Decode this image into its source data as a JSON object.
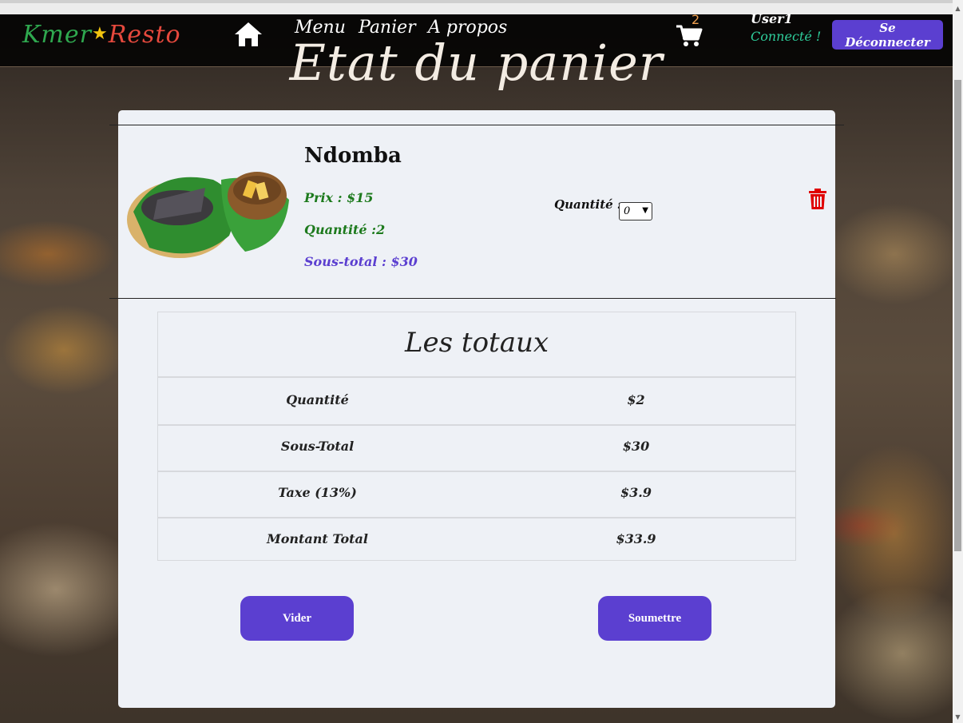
{
  "navbar": {
    "brand_part1": "Kmer",
    "brand_star": "★",
    "brand_part2": "Resto",
    "links": [
      "Menu",
      "Panier",
      "A propos"
    ],
    "cart_count": "2",
    "user_name": "User1",
    "user_status": "Connecté !",
    "logout_label": "Se Déconnecter"
  },
  "page": {
    "title": "Etat du panier"
  },
  "cart_item": {
    "name": "Ndomba",
    "price": "Prix : $15",
    "quantity": "Quantité :2",
    "subtotal": "Sous-total : $30",
    "qty_label": "Quantité :",
    "qty_select_value": "0"
  },
  "totals": {
    "title": "Les totaux",
    "rows": [
      {
        "label": "Quantité",
        "value": "$2"
      },
      {
        "label": "Sous-Total",
        "value": "$30"
      },
      {
        "label": "Taxe (13%)",
        "value": "$3.9"
      },
      {
        "label": "Montant Total",
        "value": "$33.9"
      }
    ]
  },
  "actions": {
    "clear_label": "Vider",
    "submit_label": "Soumettre"
  },
  "colors": {
    "accent": "#5b3fd0",
    "price_green": "#1d7a1d",
    "status_green": "#2ecc9a",
    "trash_red": "#e00000"
  }
}
